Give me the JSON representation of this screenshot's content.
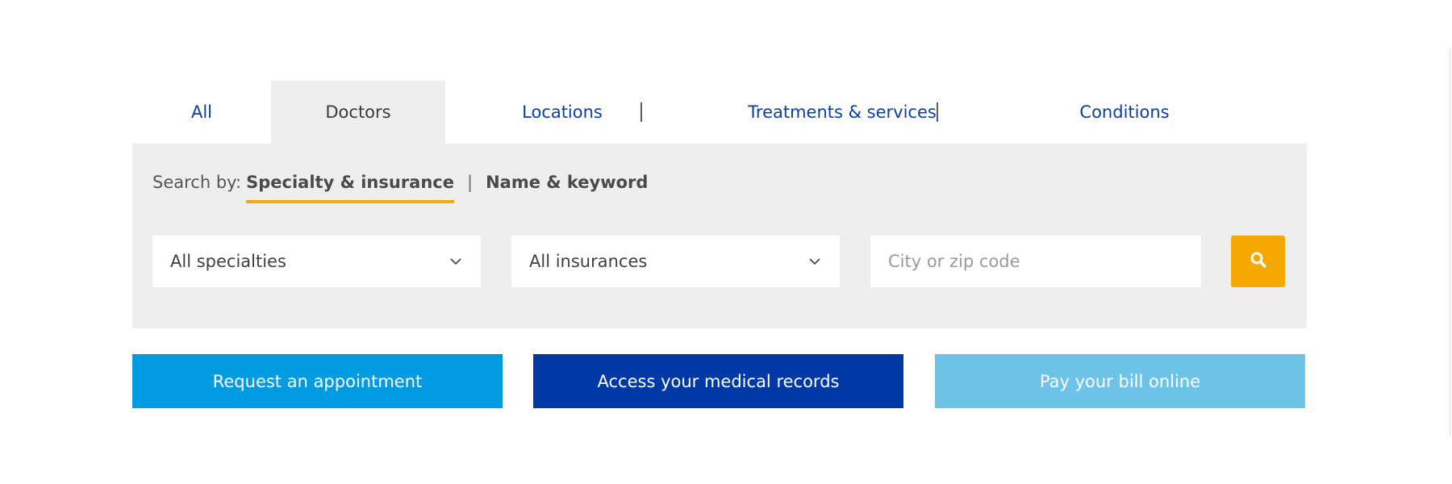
{
  "tabs": [
    {
      "label": "All",
      "active": false
    },
    {
      "label": "Doctors",
      "active": true
    },
    {
      "label": "Locations",
      "active": false
    },
    {
      "label": "Treatments & services",
      "active": false
    },
    {
      "label": "Conditions",
      "active": false
    }
  ],
  "search_by": {
    "prefix": "Search by:",
    "options": [
      "Specialty & insurance",
      "Name & keyword"
    ],
    "selected": "Specialty & insurance",
    "separator": "|"
  },
  "filters": {
    "specialty": {
      "value": "All specialties",
      "icon": "chevron-down-icon"
    },
    "insurance": {
      "value": "All insurances",
      "icon": "chevron-down-icon"
    },
    "location": {
      "placeholder": "City or zip code",
      "value": ""
    }
  },
  "search_button": {
    "icon": "search-icon"
  },
  "actions": [
    {
      "label": "Request an appointment",
      "color": "#009be0"
    },
    {
      "label": "Access your medical records",
      "color": "#0039a6"
    },
    {
      "label": "Pay your bill online",
      "color": "#6ec4e8"
    }
  ],
  "colors": {
    "link_blue": "#0a3fa8",
    "panel_bg": "#eeeeee",
    "accent_orange": "#f5a800"
  }
}
